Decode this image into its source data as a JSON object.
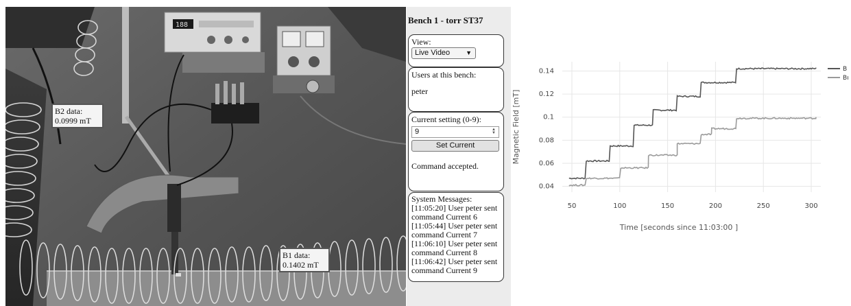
{
  "video": {
    "b2_overlay": {
      "title": "B2 data:",
      "value": "0.0999 mT"
    },
    "b1_overlay": {
      "title": "B1 data:",
      "value": "0.1402 mT"
    },
    "power_supply_display": "188"
  },
  "panel": {
    "bench_title": "Bench 1 - torr ST37",
    "view": {
      "label": "View:",
      "selected": "Live Video"
    },
    "users": {
      "label": "Users at this bench:",
      "names": "peter"
    },
    "current": {
      "label": "Current setting (0-9):",
      "input_value": "9",
      "button_label": "Set Current",
      "status": "Command accepted."
    },
    "messages": {
      "label": "System Messages:",
      "lines": [
        "[11:05:20] User peter sent",
        "command Current 6",
        "[11:05:44] User peter sent",
        "command Current 7",
        "[11:06:10] User peter sent",
        "command Current 8",
        "[11:06:42] User peter sent",
        "command Current 9"
      ]
    }
  },
  "chart_data": {
    "type": "line",
    "xlabel": "Time [seconds since 11:03:00 ]",
    "ylabel": "Magnetic Field [mT]",
    "xlim": [
      40,
      310
    ],
    "ylim": [
      0.035,
      0.148
    ],
    "xticks": [
      50,
      100,
      150,
      200,
      250,
      300
    ],
    "yticks": [
      0.04,
      0.06,
      0.08,
      0.1,
      0.12,
      0.14
    ],
    "ytick_labels": [
      "0.04",
      "0.06",
      "0.08",
      "0.1",
      "0.12",
      "0.14"
    ],
    "grid": true,
    "legend_position": "top-right",
    "series": [
      {
        "name": "B",
        "color": "#555555",
        "steps": [
          [
            47,
            0.047
          ],
          [
            65,
            0.062
          ],
          [
            90,
            0.075
          ],
          [
            115,
            0.093
          ],
          [
            135,
            0.106
          ],
          [
            160,
            0.118
          ],
          [
            185,
            0.13
          ],
          [
            222,
            0.142
          ],
          [
            305,
            0.142
          ]
        ]
      },
      {
        "name": "Bı",
        "color": "#9a9a9a",
        "steps": [
          [
            47,
            0.041
          ],
          [
            65,
            0.047
          ],
          [
            101,
            0.056
          ],
          [
            130,
            0.067
          ],
          [
            160,
            0.077
          ],
          [
            185,
            0.085
          ],
          [
            196,
            0.09
          ],
          [
            222,
            0.099
          ],
          [
            305,
            0.1
          ]
        ]
      }
    ]
  }
}
